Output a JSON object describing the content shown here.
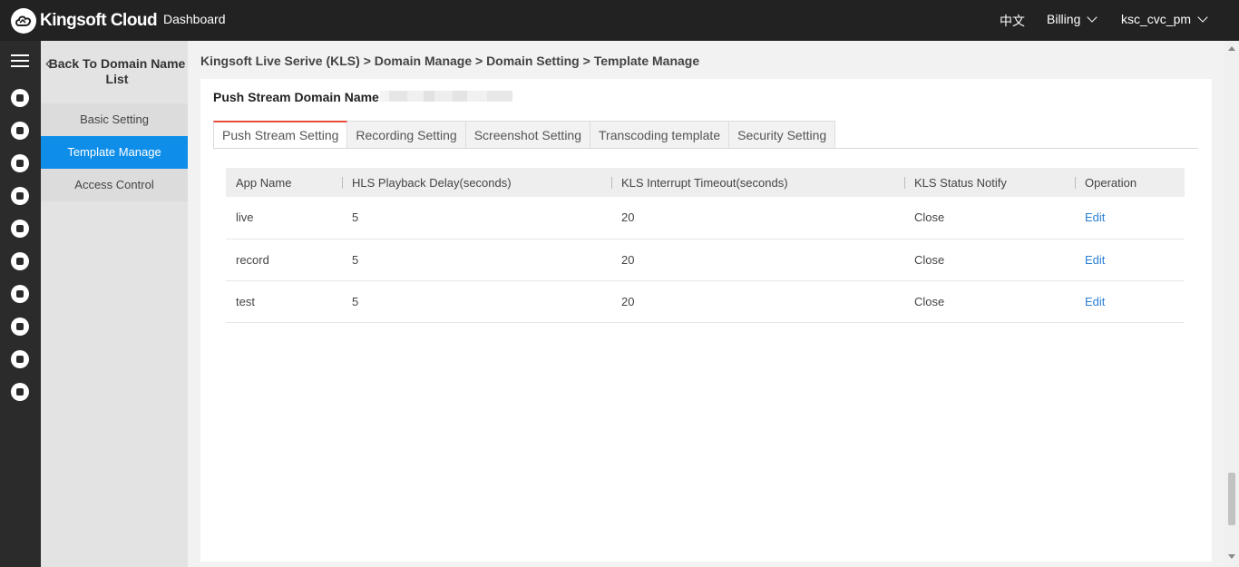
{
  "header": {
    "logo_text": "Kingsoft Cloud",
    "dashboard": "Dashboard",
    "language": "中文",
    "billing": "Billing",
    "user": "ksc_cvc_pm"
  },
  "rail": {
    "icons": [
      "menu-icon",
      "cloud-server-icon",
      "monitor-icon",
      "network-icon",
      "database-icon",
      "users-icon",
      "share-icon",
      "storage-icon",
      "stack-icon",
      "upload-cloud-icon",
      "id-card-icon"
    ]
  },
  "subnav": {
    "back_label": "Back To Domain Name List",
    "items": [
      {
        "label": "Basic Setting",
        "active": false
      },
      {
        "label": "Template Manage",
        "active": true
      },
      {
        "label": "Access Control",
        "active": false
      }
    ]
  },
  "breadcrumb": "Kingsoft Live Serive (KLS) > Domain Manage > Domain Setting > Template Manage",
  "domain_label": "Push Stream Domain Name:",
  "tabs": [
    {
      "label": "Push Stream Setting",
      "active": true
    },
    {
      "label": "Recording Setting",
      "active": false
    },
    {
      "label": "Screenshot Setting",
      "active": false
    },
    {
      "label": "Transcoding template",
      "active": false
    },
    {
      "label": "Security Setting",
      "active": false
    }
  ],
  "table": {
    "headers": [
      "App Name",
      "HLS Playback Delay(seconds)",
      "KLS Interrupt Timeout(seconds)",
      "KLS Status Notify",
      "Operation"
    ],
    "rows": [
      [
        "live",
        "5",
        "20",
        "Close",
        "Edit"
      ],
      [
        "record",
        "5",
        "20",
        "Close",
        "Edit"
      ],
      [
        "test",
        "5",
        "20",
        "Close",
        "Edit"
      ]
    ]
  },
  "colors": {
    "topbar": "#222222",
    "rail": "#2b2b2b",
    "active_nav": "#0f8ee9",
    "active_tab_border": "#e84c3d",
    "link": "#2a7fd4"
  }
}
